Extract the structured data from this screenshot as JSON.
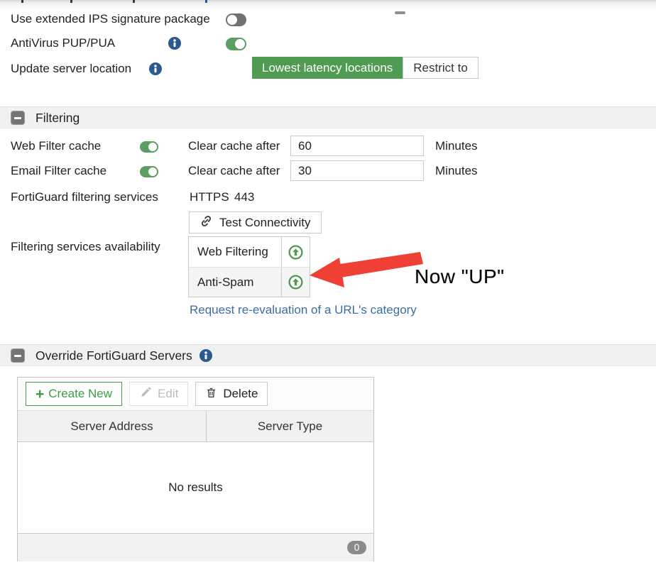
{
  "colors": {
    "accent_green": "#4f9b52",
    "toggle_green": "#5c9e60",
    "toggle_gray": "#717171",
    "create_green": "#3f9b45",
    "status_up_green": "#4e9b50",
    "link_blue": "#3a6da1",
    "info_blue": "#2a5a8f",
    "annotation_red": "#ee4035",
    "section_bar_gray": "#f1f1f1"
  },
  "icons": {
    "info": "info-circle-icon",
    "collapse": "minus-square-icon",
    "test": "chain-link-icon",
    "create": "plus-icon",
    "edit": "pencil-icon",
    "delete": "trash-icon",
    "status_up": "up-arrow-circle-icon",
    "annotation": "red-arrow-left"
  },
  "general": {
    "extended_ips_label": "Use extended IPS signature package",
    "extended_ips_state": "off",
    "antivirus_label": "AntiVirus PUP/PUA",
    "antivirus_state": "on",
    "update_server_label": "Update server location",
    "location_options": [
      "Lowest latency locations",
      "Restrict to"
    ],
    "location_selected": "Lowest latency locations"
  },
  "filtering": {
    "title": "Filtering",
    "cache_rows": [
      {
        "label": "Web Filter cache",
        "state": "on",
        "clear_label": "Clear cache after",
        "value": "60",
        "unit": "Minutes"
      },
      {
        "label": "Email Filter cache",
        "state": "on",
        "clear_label": "Clear cache after",
        "value": "30",
        "unit": "Minutes"
      }
    ],
    "services_label": "FortiGuard filtering services",
    "protocol": "HTTPS",
    "port": "443",
    "test_button": "Test Connectivity",
    "availability_label": "Filtering services availability",
    "availability_rows": [
      {
        "name": "Web Filtering",
        "status": "up"
      },
      {
        "name": "Anti-Spam",
        "status": "up"
      }
    ],
    "reevaluate_link": "Request re-evaluation of a URL's category"
  },
  "annotation": {
    "text": "Now \"UP\""
  },
  "override": {
    "title": "Override FortiGuard Servers",
    "create_button": "Create New",
    "create_plus": "+",
    "edit_button": "Edit",
    "delete_button": "Delete",
    "columns": [
      "Server Address",
      "Server Type"
    ],
    "empty_text": "No results",
    "count_badge": "0"
  }
}
